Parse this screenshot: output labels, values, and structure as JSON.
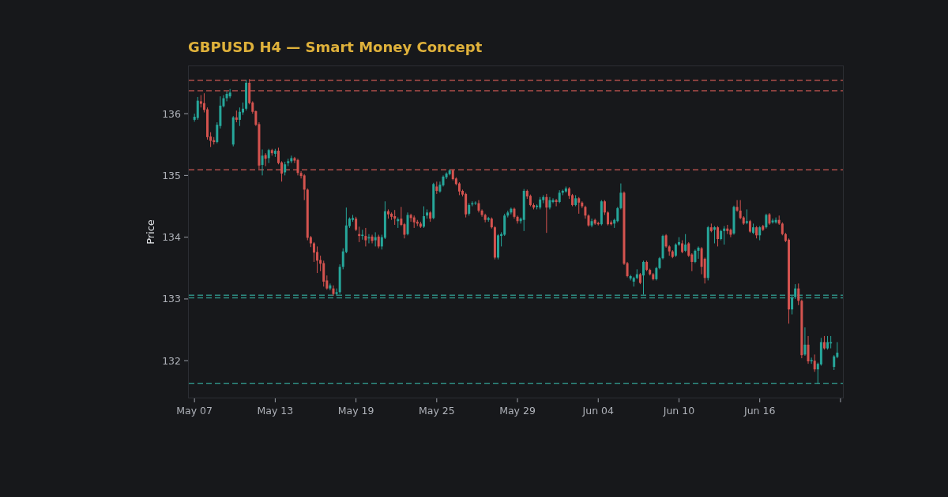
{
  "chart": {
    "chart_data": {
      "type": "candlestick",
      "title": "GBPUSD H4 — Smart Money Concept",
      "ylabel": "Price",
      "ylim": [
        131.39,
        136.78
      ],
      "yticks": [
        132,
        133,
        134,
        135,
        136
      ],
      "categories": [
        "May 07",
        null,
        null,
        null,
        null,
        null,
        null,
        null,
        null,
        null,
        null,
        null,
        null,
        null,
        null,
        null,
        null,
        null,
        null,
        null,
        null,
        null,
        null,
        null,
        null,
        "May 13",
        null,
        null,
        null,
        null,
        null,
        null,
        null,
        null,
        null,
        null,
        null,
        null,
        null,
        null,
        null,
        null,
        null,
        null,
        null,
        null,
        null,
        null,
        null,
        null,
        "May 19",
        null,
        null,
        null,
        null,
        null,
        null,
        null,
        null,
        null,
        null,
        null,
        null,
        null,
        null,
        null,
        null,
        null,
        null,
        null,
        null,
        null,
        null,
        null,
        null,
        "May 25",
        null,
        null,
        null,
        null,
        null,
        null,
        null,
        null,
        null,
        null,
        null,
        null,
        null,
        null,
        null,
        null,
        null,
        null,
        null,
        null,
        null,
        null,
        null,
        null,
        "May 29",
        null,
        null,
        null,
        null,
        null,
        null,
        null,
        null,
        null,
        null,
        null,
        null,
        null,
        null,
        null,
        null,
        null,
        null,
        null,
        null,
        null,
        null,
        null,
        null,
        "Jun 04",
        null,
        null,
        null,
        null,
        null,
        null,
        null,
        null,
        null,
        null,
        null,
        null,
        null,
        null,
        null,
        null,
        null,
        null,
        null,
        null,
        null,
        null,
        null,
        null,
        "Jun 10",
        null,
        null,
        null,
        null,
        null,
        null,
        null,
        null,
        null,
        null,
        null,
        null,
        null,
        null,
        null,
        null,
        null,
        null,
        null,
        null,
        null,
        null,
        null,
        null,
        "Jun 16",
        null,
        null,
        null,
        null,
        null,
        null,
        null,
        null,
        null,
        null,
        null,
        null,
        null,
        null,
        null,
        null,
        null,
        null,
        null,
        null,
        null,
        null,
        null,
        null
      ],
      "ohlc": [
        [
          135.9,
          136.0,
          135.87,
          135.95
        ],
        [
          135.93,
          136.27,
          135.9,
          136.21
        ],
        [
          136.2,
          136.3,
          136.1,
          136.16
        ],
        [
          136.17,
          136.33,
          136.02,
          136.06
        ],
        [
          136.07,
          136.1,
          135.58,
          135.62
        ],
        [
          135.63,
          135.7,
          135.46,
          135.56
        ],
        [
          135.57,
          135.62,
          135.5,
          135.54
        ],
        [
          135.54,
          135.86,
          135.52,
          135.82
        ],
        [
          135.8,
          136.28,
          135.76,
          136.13
        ],
        [
          136.12,
          136.3,
          136.1,
          136.25
        ],
        [
          136.25,
          136.36,
          136.2,
          136.32
        ],
        [
          136.28,
          136.4,
          136.25,
          136.34
        ],
        [
          135.5,
          135.96,
          135.47,
          135.94
        ],
        [
          135.94,
          136.05,
          135.86,
          135.9
        ],
        [
          135.9,
          136.1,
          135.8,
          136.03
        ],
        [
          136.02,
          136.18,
          135.98,
          136.08
        ],
        [
          136.08,
          136.55,
          136.05,
          136.5
        ],
        [
          136.5,
          136.56,
          136.15,
          136.17
        ],
        [
          136.18,
          136.2,
          136.0,
          136.03
        ],
        [
          136.04,
          136.05,
          135.8,
          135.82
        ],
        [
          135.83,
          135.86,
          135.1,
          135.16
        ],
        [
          135.17,
          135.42,
          135.0,
          135.32
        ],
        [
          135.33,
          135.36,
          135.15,
          135.27
        ],
        [
          135.28,
          135.43,
          135.2,
          135.41
        ],
        [
          135.41,
          135.43,
          135.32,
          135.36
        ],
        [
          135.35,
          135.43,
          135.3,
          135.4
        ],
        [
          135.4,
          135.45,
          135.18,
          135.2
        ],
        [
          135.21,
          135.23,
          134.9,
          135.03
        ],
        [
          135.05,
          135.22,
          135.0,
          135.18
        ],
        [
          135.2,
          135.27,
          135.15,
          135.23
        ],
        [
          135.23,
          135.32,
          135.2,
          135.28
        ],
        [
          135.28,
          135.3,
          135.2,
          135.24
        ],
        [
          135.25,
          135.27,
          135.0,
          135.04
        ],
        [
          135.04,
          135.07,
          134.95,
          134.99
        ],
        [
          135.0,
          135.02,
          134.6,
          134.77
        ],
        [
          134.77,
          134.79,
          133.95,
          133.99
        ],
        [
          134.0,
          134.02,
          133.84,
          133.9
        ],
        [
          133.9,
          133.92,
          133.6,
          133.75
        ],
        [
          133.76,
          133.85,
          133.42,
          133.62
        ],
        [
          133.63,
          133.7,
          133.45,
          133.57
        ],
        [
          133.58,
          133.62,
          133.2,
          133.28
        ],
        [
          133.3,
          133.38,
          133.15,
          133.17
        ],
        [
          133.17,
          133.25,
          133.14,
          133.22
        ],
        [
          133.17,
          133.22,
          133.05,
          133.08
        ],
        [
          133.08,
          133.17,
          133.05,
          133.11
        ],
        [
          133.11,
          133.56,
          133.08,
          133.52
        ],
        [
          133.52,
          133.82,
          133.48,
          133.77
        ],
        [
          133.76,
          134.48,
          133.74,
          134.19
        ],
        [
          134.18,
          134.32,
          134.15,
          134.3
        ],
        [
          134.28,
          134.36,
          134.25,
          134.31
        ],
        [
          134.3,
          134.33,
          134.1,
          134.12
        ],
        [
          134.05,
          134.17,
          133.92,
          134.02
        ],
        [
          134.02,
          134.12,
          133.96,
          134.04
        ],
        [
          134.02,
          134.15,
          133.85,
          133.95
        ],
        [
          133.98,
          134.05,
          133.9,
          134.0
        ],
        [
          134.01,
          134.04,
          133.9,
          133.94
        ],
        [
          133.95,
          134.08,
          133.85,
          134.0
        ],
        [
          134.01,
          134.04,
          133.82,
          133.85
        ],
        [
          133.85,
          134.04,
          133.8,
          134.0
        ],
        [
          133.99,
          134.58,
          133.97,
          134.42
        ],
        [
          134.42,
          134.45,
          134.3,
          134.37
        ],
        [
          134.38,
          134.4,
          134.28,
          134.33
        ],
        [
          134.34,
          134.44,
          134.2,
          134.3
        ],
        [
          134.26,
          134.32,
          134.15,
          134.29
        ],
        [
          134.3,
          134.49,
          134.18,
          134.2
        ],
        [
          134.21,
          134.23,
          133.98,
          134.04
        ],
        [
          134.05,
          134.4,
          134.03,
          134.36
        ],
        [
          134.36,
          134.38,
          134.25,
          134.31
        ],
        [
          134.32,
          134.35,
          134.15,
          134.24
        ],
        [
          134.25,
          134.28,
          134.18,
          134.22
        ],
        [
          134.22,
          134.25,
          134.15,
          134.17
        ],
        [
          134.17,
          134.5,
          134.15,
          134.34
        ],
        [
          134.35,
          134.45,
          134.3,
          134.4
        ],
        [
          134.4,
          134.42,
          134.25,
          134.3
        ],
        [
          134.31,
          134.88,
          134.29,
          134.86
        ],
        [
          134.82,
          134.9,
          134.7,
          134.75
        ],
        [
          134.74,
          134.9,
          134.72,
          134.85
        ],
        [
          134.84,
          135.0,
          134.82,
          134.98
        ],
        [
          134.97,
          135.05,
          134.94,
          135.03
        ],
        [
          135.02,
          135.1,
          135.0,
          135.08
        ],
        [
          135.08,
          135.1,
          134.92,
          134.94
        ],
        [
          134.95,
          134.97,
          134.84,
          134.86
        ],
        [
          134.87,
          134.89,
          134.68,
          134.74
        ],
        [
          134.75,
          134.77,
          134.66,
          134.69
        ],
        [
          134.7,
          134.72,
          134.32,
          134.37
        ],
        [
          134.38,
          134.55,
          134.35,
          134.52
        ],
        [
          134.53,
          134.58,
          134.5,
          134.55
        ],
        [
          134.55,
          134.58,
          134.52,
          134.56
        ],
        [
          134.55,
          134.6,
          134.4,
          134.43
        ],
        [
          134.43,
          134.45,
          134.33,
          134.36
        ],
        [
          134.36,
          134.38,
          134.24,
          134.28
        ],
        [
          134.28,
          134.33,
          134.25,
          134.31
        ],
        [
          134.3,
          134.32,
          134.14,
          134.16
        ],
        [
          134.16,
          134.18,
          133.64,
          133.67
        ],
        [
          133.67,
          134.05,
          133.64,
          134.03
        ],
        [
          134.02,
          134.08,
          133.85,
          134.05
        ],
        [
          134.04,
          134.38,
          134.02,
          134.35
        ],
        [
          134.35,
          134.43,
          134.32,
          134.4
        ],
        [
          134.4,
          134.48,
          134.37,
          134.46
        ],
        [
          134.46,
          134.48,
          134.3,
          134.33
        ],
        [
          134.33,
          134.35,
          134.22,
          134.26
        ],
        [
          134.26,
          134.32,
          134.22,
          134.3
        ],
        [
          134.28,
          134.78,
          134.1,
          134.75
        ],
        [
          134.75,
          134.77,
          134.62,
          134.66
        ],
        [
          134.67,
          134.69,
          134.5,
          134.52
        ],
        [
          134.52,
          134.55,
          134.45,
          134.48
        ],
        [
          134.49,
          134.53,
          134.45,
          134.51
        ],
        [
          134.48,
          134.65,
          134.45,
          134.61
        ],
        [
          134.6,
          134.68,
          134.55,
          134.65
        ],
        [
          134.65,
          134.7,
          134.07,
          134.48
        ],
        [
          134.48,
          134.65,
          134.45,
          134.6
        ],
        [
          134.57,
          134.63,
          134.55,
          134.6
        ],
        [
          134.6,
          134.62,
          134.5,
          134.57
        ],
        [
          134.57,
          134.76,
          134.55,
          134.72
        ],
        [
          134.72,
          134.77,
          134.68,
          134.75
        ],
        [
          134.74,
          134.82,
          134.72,
          134.79
        ],
        [
          134.79,
          134.81,
          134.62,
          134.67
        ],
        [
          134.68,
          134.7,
          134.5,
          134.52
        ],
        [
          134.52,
          134.68,
          134.5,
          134.63
        ],
        [
          134.63,
          134.65,
          134.38,
          134.56
        ],
        [
          134.56,
          134.58,
          134.47,
          134.5
        ],
        [
          134.49,
          134.51,
          134.3,
          134.35
        ],
        [
          134.35,
          134.37,
          134.17,
          134.19
        ],
        [
          134.19,
          134.3,
          134.16,
          134.26
        ],
        [
          134.28,
          134.3,
          134.2,
          134.22
        ],
        [
          134.23,
          134.25,
          134.19,
          134.21
        ],
        [
          134.21,
          134.6,
          134.19,
          134.58
        ],
        [
          134.58,
          134.6,
          134.36,
          134.4
        ],
        [
          134.4,
          134.42,
          134.19,
          134.21
        ],
        [
          134.24,
          134.27,
          134.19,
          134.21
        ],
        [
          134.22,
          134.3,
          134.15,
          134.28
        ],
        [
          134.26,
          134.49,
          134.24,
          134.47
        ],
        [
          134.47,
          134.87,
          134.45,
          134.72
        ],
        [
          134.72,
          134.74,
          133.55,
          133.57
        ],
        [
          133.58,
          133.6,
          133.35,
          133.37
        ],
        [
          133.33,
          133.39,
          133.3,
          133.37
        ],
        [
          133.28,
          133.36,
          133.2,
          133.34
        ],
        [
          133.34,
          133.48,
          133.32,
          133.4
        ],
        [
          133.4,
          133.42,
          133.24,
          133.26
        ],
        [
          133.38,
          133.62,
          133.07,
          133.6
        ],
        [
          133.6,
          133.62,
          133.45,
          133.47
        ],
        [
          133.47,
          133.49,
          133.38,
          133.4
        ],
        [
          133.4,
          133.42,
          133.3,
          133.32
        ],
        [
          133.32,
          133.52,
          133.3,
          133.5
        ],
        [
          133.5,
          133.68,
          133.48,
          133.66
        ],
        [
          133.66,
          134.04,
          133.64,
          134.02
        ],
        [
          134.03,
          134.05,
          133.83,
          133.85
        ],
        [
          133.85,
          133.87,
          133.7,
          133.77
        ],
        [
          133.77,
          133.79,
          133.66,
          133.68
        ],
        [
          133.7,
          133.9,
          133.68,
          133.88
        ],
        [
          133.88,
          134.0,
          133.86,
          133.92
        ],
        [
          133.9,
          133.95,
          133.74,
          133.76
        ],
        [
          133.78,
          134.05,
          133.76,
          133.88
        ],
        [
          133.9,
          133.92,
          133.68,
          133.7
        ],
        [
          133.72,
          133.74,
          133.45,
          133.6
        ],
        [
          133.6,
          133.8,
          133.58,
          133.78
        ],
        [
          133.78,
          133.85,
          133.65,
          133.83
        ],
        [
          133.82,
          133.84,
          133.4,
          133.52
        ],
        [
          133.65,
          133.67,
          133.25,
          133.34
        ],
        [
          133.34,
          134.18,
          133.3,
          134.16
        ],
        [
          134.16,
          134.22,
          134.08,
          134.1
        ],
        [
          134.12,
          134.18,
          133.9,
          134.16
        ],
        [
          134.16,
          134.18,
          133.85,
          133.97
        ],
        [
          133.97,
          134.12,
          133.95,
          134.1
        ],
        [
          134.1,
          134.18,
          133.88,
          134.14
        ],
        [
          134.14,
          134.2,
          134.05,
          134.1
        ],
        [
          134.12,
          134.14,
          134.0,
          134.04
        ],
        [
          134.06,
          134.51,
          134.04,
          134.49
        ],
        [
          134.49,
          134.6,
          134.41,
          134.43
        ],
        [
          134.43,
          134.6,
          134.29,
          134.31
        ],
        [
          134.32,
          134.34,
          134.2,
          134.22
        ],
        [
          134.23,
          134.45,
          134.21,
          134.26
        ],
        [
          134.26,
          134.28,
          134.07,
          134.09
        ],
        [
          134.07,
          134.22,
          134.05,
          134.16
        ],
        [
          134.16,
          134.18,
          133.98,
          134.03
        ],
        [
          134.03,
          134.18,
          133.95,
          134.16
        ],
        [
          134.18,
          134.2,
          134.1,
          134.12
        ],
        [
          134.16,
          134.38,
          134.14,
          134.36
        ],
        [
          134.37,
          134.39,
          134.2,
          134.22
        ],
        [
          134.24,
          134.3,
          134.22,
          134.27
        ],
        [
          134.24,
          134.32,
          134.22,
          134.28
        ],
        [
          134.28,
          134.35,
          134.2,
          134.22
        ],
        [
          134.22,
          134.24,
          134.03,
          134.05
        ],
        [
          134.05,
          134.07,
          133.92,
          133.94
        ],
        [
          133.96,
          133.98,
          132.6,
          132.83
        ],
        [
          132.83,
          133.05,
          132.75,
          133.02
        ],
        [
          133.03,
          133.24,
          133.0,
          133.17
        ],
        [
          133.17,
          133.25,
          132.9,
          132.97
        ],
        [
          132.97,
          132.99,
          132.04,
          132.09
        ],
        [
          132.1,
          132.54,
          132.08,
          132.26
        ],
        [
          132.26,
          132.4,
          131.95,
          131.99
        ],
        [
          131.99,
          132.05,
          131.95,
          132.01
        ],
        [
          132.0,
          132.1,
          131.82,
          131.86
        ],
        [
          131.86,
          131.97,
          131.63,
          131.95
        ],
        [
          131.94,
          132.37,
          131.92,
          132.3
        ],
        [
          132.3,
          132.4,
          132.18,
          132.2
        ],
        [
          132.2,
          132.4,
          132.18,
          132.3
        ],
        [
          132.28,
          132.4,
          132.2,
          132.3
        ],
        [
          131.9,
          132.09,
          131.85,
          132.07
        ],
        [
          132.06,
          132.3,
          132.04,
          132.13
        ]
      ],
      "ref_lines": [
        {
          "axis": "y",
          "value": 136.54,
          "color": "#b04e4b"
        },
        {
          "axis": "y",
          "value": 136.37,
          "color": "#b04e4b"
        },
        {
          "axis": "y",
          "value": 135.09,
          "color": "#b04e4b"
        },
        {
          "axis": "y",
          "value": 133.06,
          "color": "#2e8b81"
        },
        {
          "axis": "y",
          "value": 133.02,
          "color": "#2e8b81"
        },
        {
          "axis": "y",
          "value": 131.63,
          "color": "#2e8b81"
        }
      ]
    }
  }
}
